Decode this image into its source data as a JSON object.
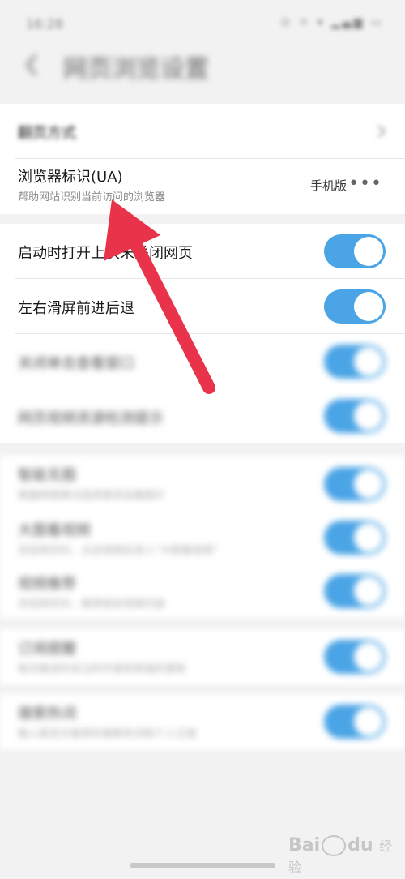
{
  "status_bar": {
    "time": "16:28",
    "icons": "⊙ ☼ ▾ ▂▄▆ ▭"
  },
  "header": {
    "title": "网页浏览设置"
  },
  "card1": {
    "row_top": {
      "title": "翻页方式"
    },
    "ua": {
      "title": "浏览器标识(UA)",
      "subtitle": "帮助网站识别当前访问的浏览器",
      "value": "手机版",
      "more": "•••"
    }
  },
  "card2": {
    "items": [
      {
        "title": "启动时打开上次未关闭网页",
        "on": true
      },
      {
        "title": "左右滑屏前进后退",
        "on": true
      },
      {
        "title": "关闭单击查看窗口",
        "on": true
      },
      {
        "title": "网页视频资源检测提示",
        "on": true
      }
    ]
  },
  "card3": {
    "items": [
      {
        "title": "智能无图",
        "subtitle": "根据网络情况选择是否加载图片",
        "on": true
      },
      {
        "title": "大图看视频",
        "subtitle": "浏览网页时，点击视频后进入“大图看视频”",
        "on": true
      },
      {
        "title": "视频推荐",
        "subtitle": "浏览网页时，推荐相关视频内容",
        "on": true
      }
    ]
  },
  "card4": {
    "item": {
      "title": "订阅提醒",
      "subtitle": "每日推送你关注的作者和频道的更新",
      "on": true
    }
  },
  "card5": {
    "item": {
      "title": "搜索热词",
      "subtitle": "输入框显示推荐的搜索热词和个人记录",
      "on": true
    }
  },
  "watermark": {
    "brand": "Bai",
    "brand2": "du",
    "label": "经验"
  },
  "colors": {
    "toggle_on": "#4aa4e6",
    "arrow": "#e8334a",
    "background": "#f2f2f2"
  }
}
